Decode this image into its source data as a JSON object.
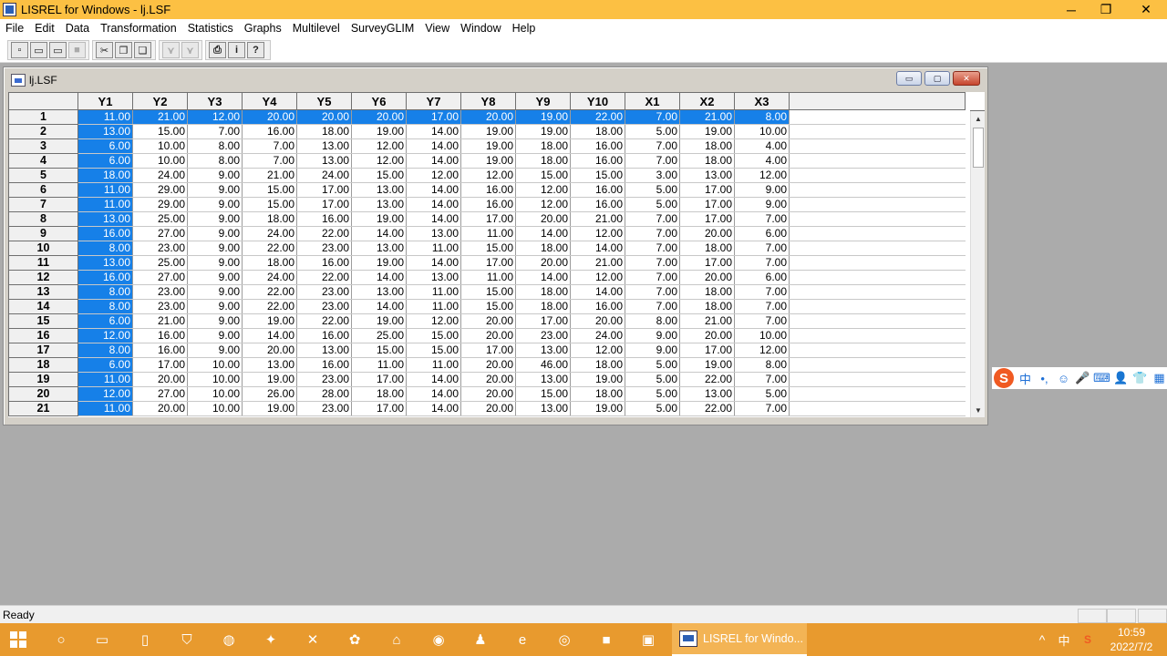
{
  "window": {
    "title": "LISREL for Windows - lj.LSF",
    "minimize": "─",
    "restore": "❐",
    "close": "✕"
  },
  "menu": [
    "File",
    "Edit",
    "Data",
    "Transformation",
    "Statistics",
    "Graphs",
    "Multilevel",
    "SurveyGLIM",
    "View",
    "Window",
    "Help"
  ],
  "toolbar": {
    "group1": [
      {
        "name": "new-file-button",
        "glyph": "▫"
      },
      {
        "name": "open-file-button",
        "glyph": "▭"
      },
      {
        "name": "open-folder-button",
        "glyph": "▭"
      },
      {
        "name": "save-button",
        "glyph": "■"
      }
    ],
    "group2": [
      {
        "name": "cut-button",
        "glyph": "✂"
      },
      {
        "name": "copy-button",
        "glyph": "❐"
      },
      {
        "name": "paste-button",
        "glyph": "❏"
      }
    ],
    "group3": [
      {
        "name": "path-diagram-button",
        "glyph": "⋎"
      },
      {
        "name": "path-diagram2-button",
        "glyph": "⋎"
      }
    ],
    "group4": [
      {
        "name": "print-button",
        "glyph": "⎙"
      },
      {
        "name": "info-button",
        "glyph": "i"
      },
      {
        "name": "help-button",
        "glyph": "?"
      }
    ]
  },
  "child": {
    "title": "lj.LSF",
    "min": "▭",
    "max": "▢",
    "close": "✕"
  },
  "grid": {
    "columns": [
      "Y1",
      "Y2",
      "Y3",
      "Y4",
      "Y5",
      "Y6",
      "Y7",
      "Y8",
      "Y9",
      "Y10",
      "X1",
      "X2",
      "X3"
    ],
    "rows": [
      [
        "1",
        "11.00",
        "21.00",
        "12.00",
        "20.00",
        "20.00",
        "20.00",
        "17.00",
        "20.00",
        "19.00",
        "22.00",
        "7.00",
        "21.00",
        "8.00"
      ],
      [
        "2",
        "13.00",
        "15.00",
        "7.00",
        "16.00",
        "18.00",
        "19.00",
        "14.00",
        "19.00",
        "19.00",
        "18.00",
        "5.00",
        "19.00",
        "10.00"
      ],
      [
        "3",
        "6.00",
        "10.00",
        "8.00",
        "7.00",
        "13.00",
        "12.00",
        "14.00",
        "19.00",
        "18.00",
        "16.00",
        "7.00",
        "18.00",
        "4.00"
      ],
      [
        "4",
        "6.00",
        "10.00",
        "8.00",
        "7.00",
        "13.00",
        "12.00",
        "14.00",
        "19.00",
        "18.00",
        "16.00",
        "7.00",
        "18.00",
        "4.00"
      ],
      [
        "5",
        "18.00",
        "24.00",
        "9.00",
        "21.00",
        "24.00",
        "15.00",
        "12.00",
        "12.00",
        "15.00",
        "15.00",
        "3.00",
        "13.00",
        "12.00"
      ],
      [
        "6",
        "11.00",
        "29.00",
        "9.00",
        "15.00",
        "17.00",
        "13.00",
        "14.00",
        "16.00",
        "12.00",
        "16.00",
        "5.00",
        "17.00",
        "9.00"
      ],
      [
        "7",
        "11.00",
        "29.00",
        "9.00",
        "15.00",
        "17.00",
        "13.00",
        "14.00",
        "16.00",
        "12.00",
        "16.00",
        "5.00",
        "17.00",
        "9.00"
      ],
      [
        "8",
        "13.00",
        "25.00",
        "9.00",
        "18.00",
        "16.00",
        "19.00",
        "14.00",
        "17.00",
        "20.00",
        "21.00",
        "7.00",
        "17.00",
        "7.00"
      ],
      [
        "9",
        "16.00",
        "27.00",
        "9.00",
        "24.00",
        "22.00",
        "14.00",
        "13.00",
        "11.00",
        "14.00",
        "12.00",
        "7.00",
        "20.00",
        "6.00"
      ],
      [
        "10",
        "8.00",
        "23.00",
        "9.00",
        "22.00",
        "23.00",
        "13.00",
        "11.00",
        "15.00",
        "18.00",
        "14.00",
        "7.00",
        "18.00",
        "7.00"
      ],
      [
        "11",
        "13.00",
        "25.00",
        "9.00",
        "18.00",
        "16.00",
        "19.00",
        "14.00",
        "17.00",
        "20.00",
        "21.00",
        "7.00",
        "17.00",
        "7.00"
      ],
      [
        "12",
        "16.00",
        "27.00",
        "9.00",
        "24.00",
        "22.00",
        "14.00",
        "13.00",
        "11.00",
        "14.00",
        "12.00",
        "7.00",
        "20.00",
        "6.00"
      ],
      [
        "13",
        "8.00",
        "23.00",
        "9.00",
        "22.00",
        "23.00",
        "13.00",
        "11.00",
        "15.00",
        "18.00",
        "14.00",
        "7.00",
        "18.00",
        "7.00"
      ],
      [
        "14",
        "8.00",
        "23.00",
        "9.00",
        "22.00",
        "23.00",
        "14.00",
        "11.00",
        "15.00",
        "18.00",
        "16.00",
        "7.00",
        "18.00",
        "7.00"
      ],
      [
        "15",
        "6.00",
        "21.00",
        "9.00",
        "19.00",
        "22.00",
        "19.00",
        "12.00",
        "20.00",
        "17.00",
        "20.00",
        "8.00",
        "21.00",
        "7.00"
      ],
      [
        "16",
        "12.00",
        "16.00",
        "9.00",
        "14.00",
        "16.00",
        "25.00",
        "15.00",
        "20.00",
        "23.00",
        "24.00",
        "9.00",
        "20.00",
        "10.00"
      ],
      [
        "17",
        "8.00",
        "16.00",
        "9.00",
        "20.00",
        "13.00",
        "15.00",
        "15.00",
        "17.00",
        "13.00",
        "12.00",
        "9.00",
        "17.00",
        "12.00"
      ],
      [
        "18",
        "6.00",
        "17.00",
        "10.00",
        "13.00",
        "16.00",
        "11.00",
        "11.00",
        "20.00",
        "46.00",
        "18.00",
        "5.00",
        "19.00",
        "8.00"
      ],
      [
        "19",
        "11.00",
        "20.00",
        "10.00",
        "19.00",
        "23.00",
        "17.00",
        "14.00",
        "20.00",
        "13.00",
        "19.00",
        "5.00",
        "22.00",
        "7.00"
      ],
      [
        "20",
        "12.00",
        "27.00",
        "10.00",
        "26.00",
        "28.00",
        "18.00",
        "14.00",
        "20.00",
        "15.00",
        "18.00",
        "5.00",
        "13.00",
        "5.00"
      ],
      [
        "21",
        "11.00",
        "20.00",
        "10.00",
        "19.00",
        "23.00",
        "17.00",
        "14.00",
        "20.00",
        "13.00",
        "19.00",
        "5.00",
        "22.00",
        "7.00"
      ]
    ],
    "selected_row": "1",
    "selected_column": "Y1"
  },
  "status": {
    "text": "Ready"
  },
  "ime": {
    "logo": "S",
    "icons": [
      "中",
      "•,",
      "☺",
      "🎤",
      "⌨",
      "👤",
      "👕",
      "▦"
    ]
  },
  "taskbar": {
    "active_task_label": "LISREL for Windo...",
    "tray": {
      "chevron": "^",
      "ime_lang": "中",
      "time": "10:59",
      "date": "2022/7/2"
    }
  },
  "colors": {
    "titlebar": "#fcc043",
    "taskbar": "#e89a2e",
    "selection": "#1680e8",
    "desktop": "#ababab"
  }
}
